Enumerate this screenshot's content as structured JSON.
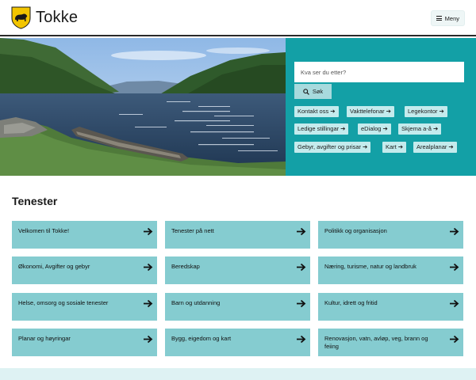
{
  "header": {
    "brand": "Tokke",
    "menu_label": "Meny"
  },
  "search": {
    "placeholder": "Kva ser du etter?",
    "button_label": "Søk"
  },
  "quick_links": [
    "Kontakt oss",
    "Vakttelefonar",
    "Legekontor",
    "Ledige stillingar",
    "eDialog",
    "Skjema a-å",
    "Gebyr, avgifter og prisar",
    "Kart",
    "Arealplanar"
  ],
  "services": {
    "title": "Tenester",
    "tiles": [
      "Velkomen til Tokke!",
      "Tenester på nett",
      "Politikk og organisasjon",
      "Økonomi, Avgifter og gebyr",
      "Beredskap",
      "Næring, turisme, natur og landbruk",
      "Helse, omsorg og sosiale tenester",
      "Barn og utdanning",
      "Kultur, idrett og fritid",
      "Planar og høyringar",
      "Bygg, eigedom og kart",
      "Renovasjon, vatn, avløp, veg, brann og feiing"
    ]
  },
  "colors": {
    "accent": "#13a0a6",
    "tile": "#85ccd0",
    "quick_link": "#c4ebed",
    "crest": "#f2c500"
  }
}
